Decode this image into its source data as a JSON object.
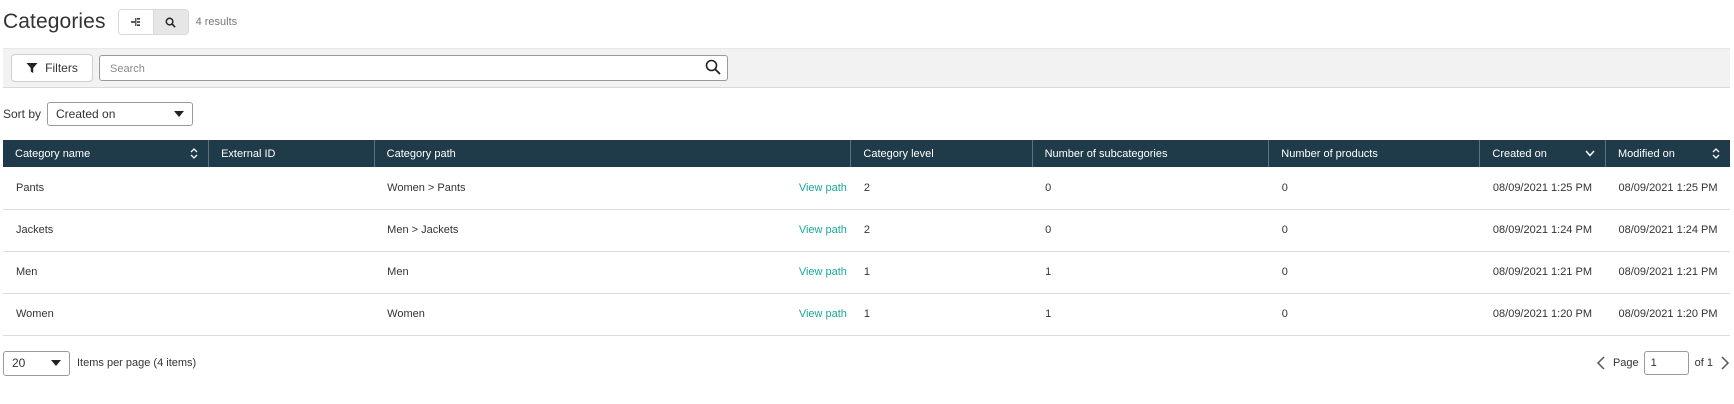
{
  "header": {
    "title": "Categories",
    "results": "4 results",
    "view_icons": [
      "tree-icon",
      "search-icon"
    ]
  },
  "filter_bar": {
    "filters_label": "Filters",
    "search_placeholder": "Search",
    "search_value": ""
  },
  "sort": {
    "label": "Sort by",
    "selected": "Created on"
  },
  "table": {
    "columns": [
      "Category name",
      "External ID",
      "Category path",
      "Category level",
      "Number of subcategories",
      "Number of products",
      "Created on",
      "Modified on"
    ],
    "view_path_label": "View path",
    "rows": [
      {
        "name": "Pants",
        "external_id": "",
        "path": "Women > Pants",
        "level": "2",
        "subcategories": "0",
        "products": "0",
        "created": "08/09/2021 1:25 PM",
        "modified": "08/09/2021 1:25 PM"
      },
      {
        "name": "Jackets",
        "external_id": "",
        "path": "Men > Jackets",
        "level": "2",
        "subcategories": "0",
        "products": "0",
        "created": "08/09/2021 1:24 PM",
        "modified": "08/09/2021 1:24 PM"
      },
      {
        "name": "Men",
        "external_id": "",
        "path": "Men",
        "level": "1",
        "subcategories": "1",
        "products": "0",
        "created": "08/09/2021 1:21 PM",
        "modified": "08/09/2021 1:21 PM"
      },
      {
        "name": "Women",
        "external_id": "",
        "path": "Women",
        "level": "1",
        "subcategories": "1",
        "products": "0",
        "created": "08/09/2021 1:20 PM",
        "modified": "08/09/2021 1:20 PM"
      }
    ]
  },
  "pagination": {
    "per_page": "20",
    "items_label": "Items per page (4 items)",
    "page_label": "Page",
    "page_value": "1",
    "of_label": "of 1"
  },
  "colors": {
    "header_bg": "#1f3a48",
    "link": "#1aa89a",
    "filter_bar_bg": "#f2f2f2"
  }
}
